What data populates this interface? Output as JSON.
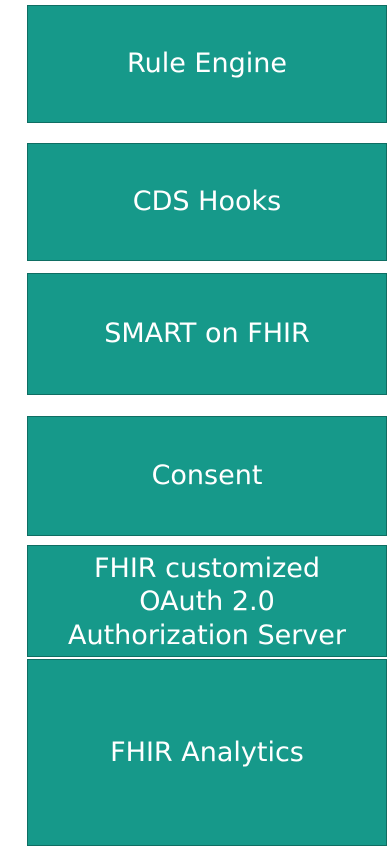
{
  "boxes": [
    {
      "label": "Rule Engine"
    },
    {
      "label": "CDS Hooks"
    },
    {
      "label": "SMART on FHIR"
    },
    {
      "label": "Consent"
    },
    {
      "label": "FHIR customized\nOAuth 2.0\nAuthorization Server"
    },
    {
      "label": "FHIR Analytics"
    }
  ],
  "colors": {
    "box_fill": "#16998a",
    "box_border": "#0f6e63",
    "text": "#ffffff"
  }
}
